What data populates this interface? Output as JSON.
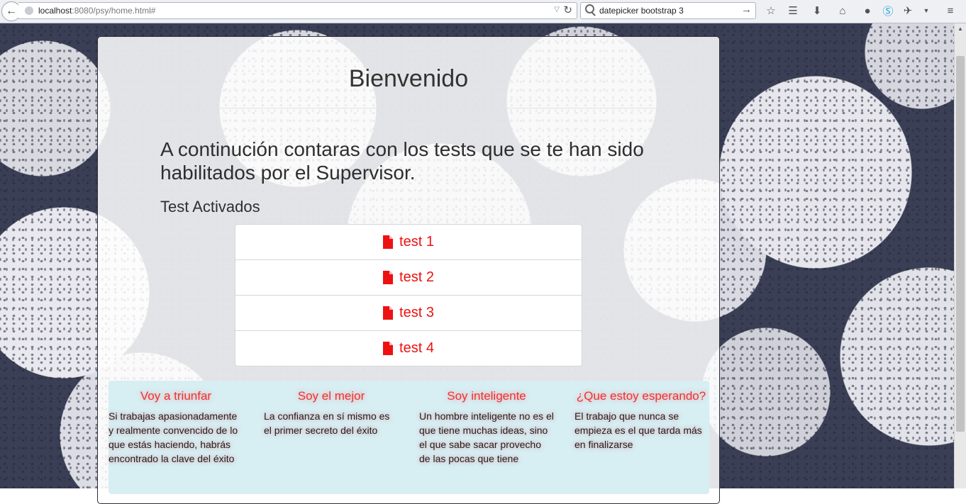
{
  "browser": {
    "url_host": "localhost",
    "url_rest": ":8080/psy/home.html#",
    "search_query": "datepicker bootstrap 3"
  },
  "page": {
    "title": "Bienvenido",
    "intro": "A continución contaras con los tests que se te han sido habilitados por el Supervisor.",
    "section_heading": "Test Activados",
    "tests": [
      {
        "label": "test 1"
      },
      {
        "label": "test 2"
      },
      {
        "label": "test 3"
      },
      {
        "label": "test 4"
      }
    ],
    "accent_color": "#ee1111",
    "quotes": [
      {
        "title": "Voy a triunfar",
        "body": "Si trabajas apasionadamente y realmente convencido de lo que estás haciendo, habrás encontrado la clave del éxito"
      },
      {
        "title": "Soy el mejor",
        "body": "La confianza en sí mismo es el primer secreto del éxito"
      },
      {
        "title": "Soy inteligente",
        "body": "Un hombre inteligente no es el que tiene muchas ideas, sino el que sabe sacar provecho de las pocas que tiene"
      },
      {
        "title": "¿Que estoy esperando?",
        "body": "El trabajo que nunca se empieza es el que tarda más en finalizarse"
      }
    ],
    "quotes_bg_color": "#d7eef3"
  }
}
